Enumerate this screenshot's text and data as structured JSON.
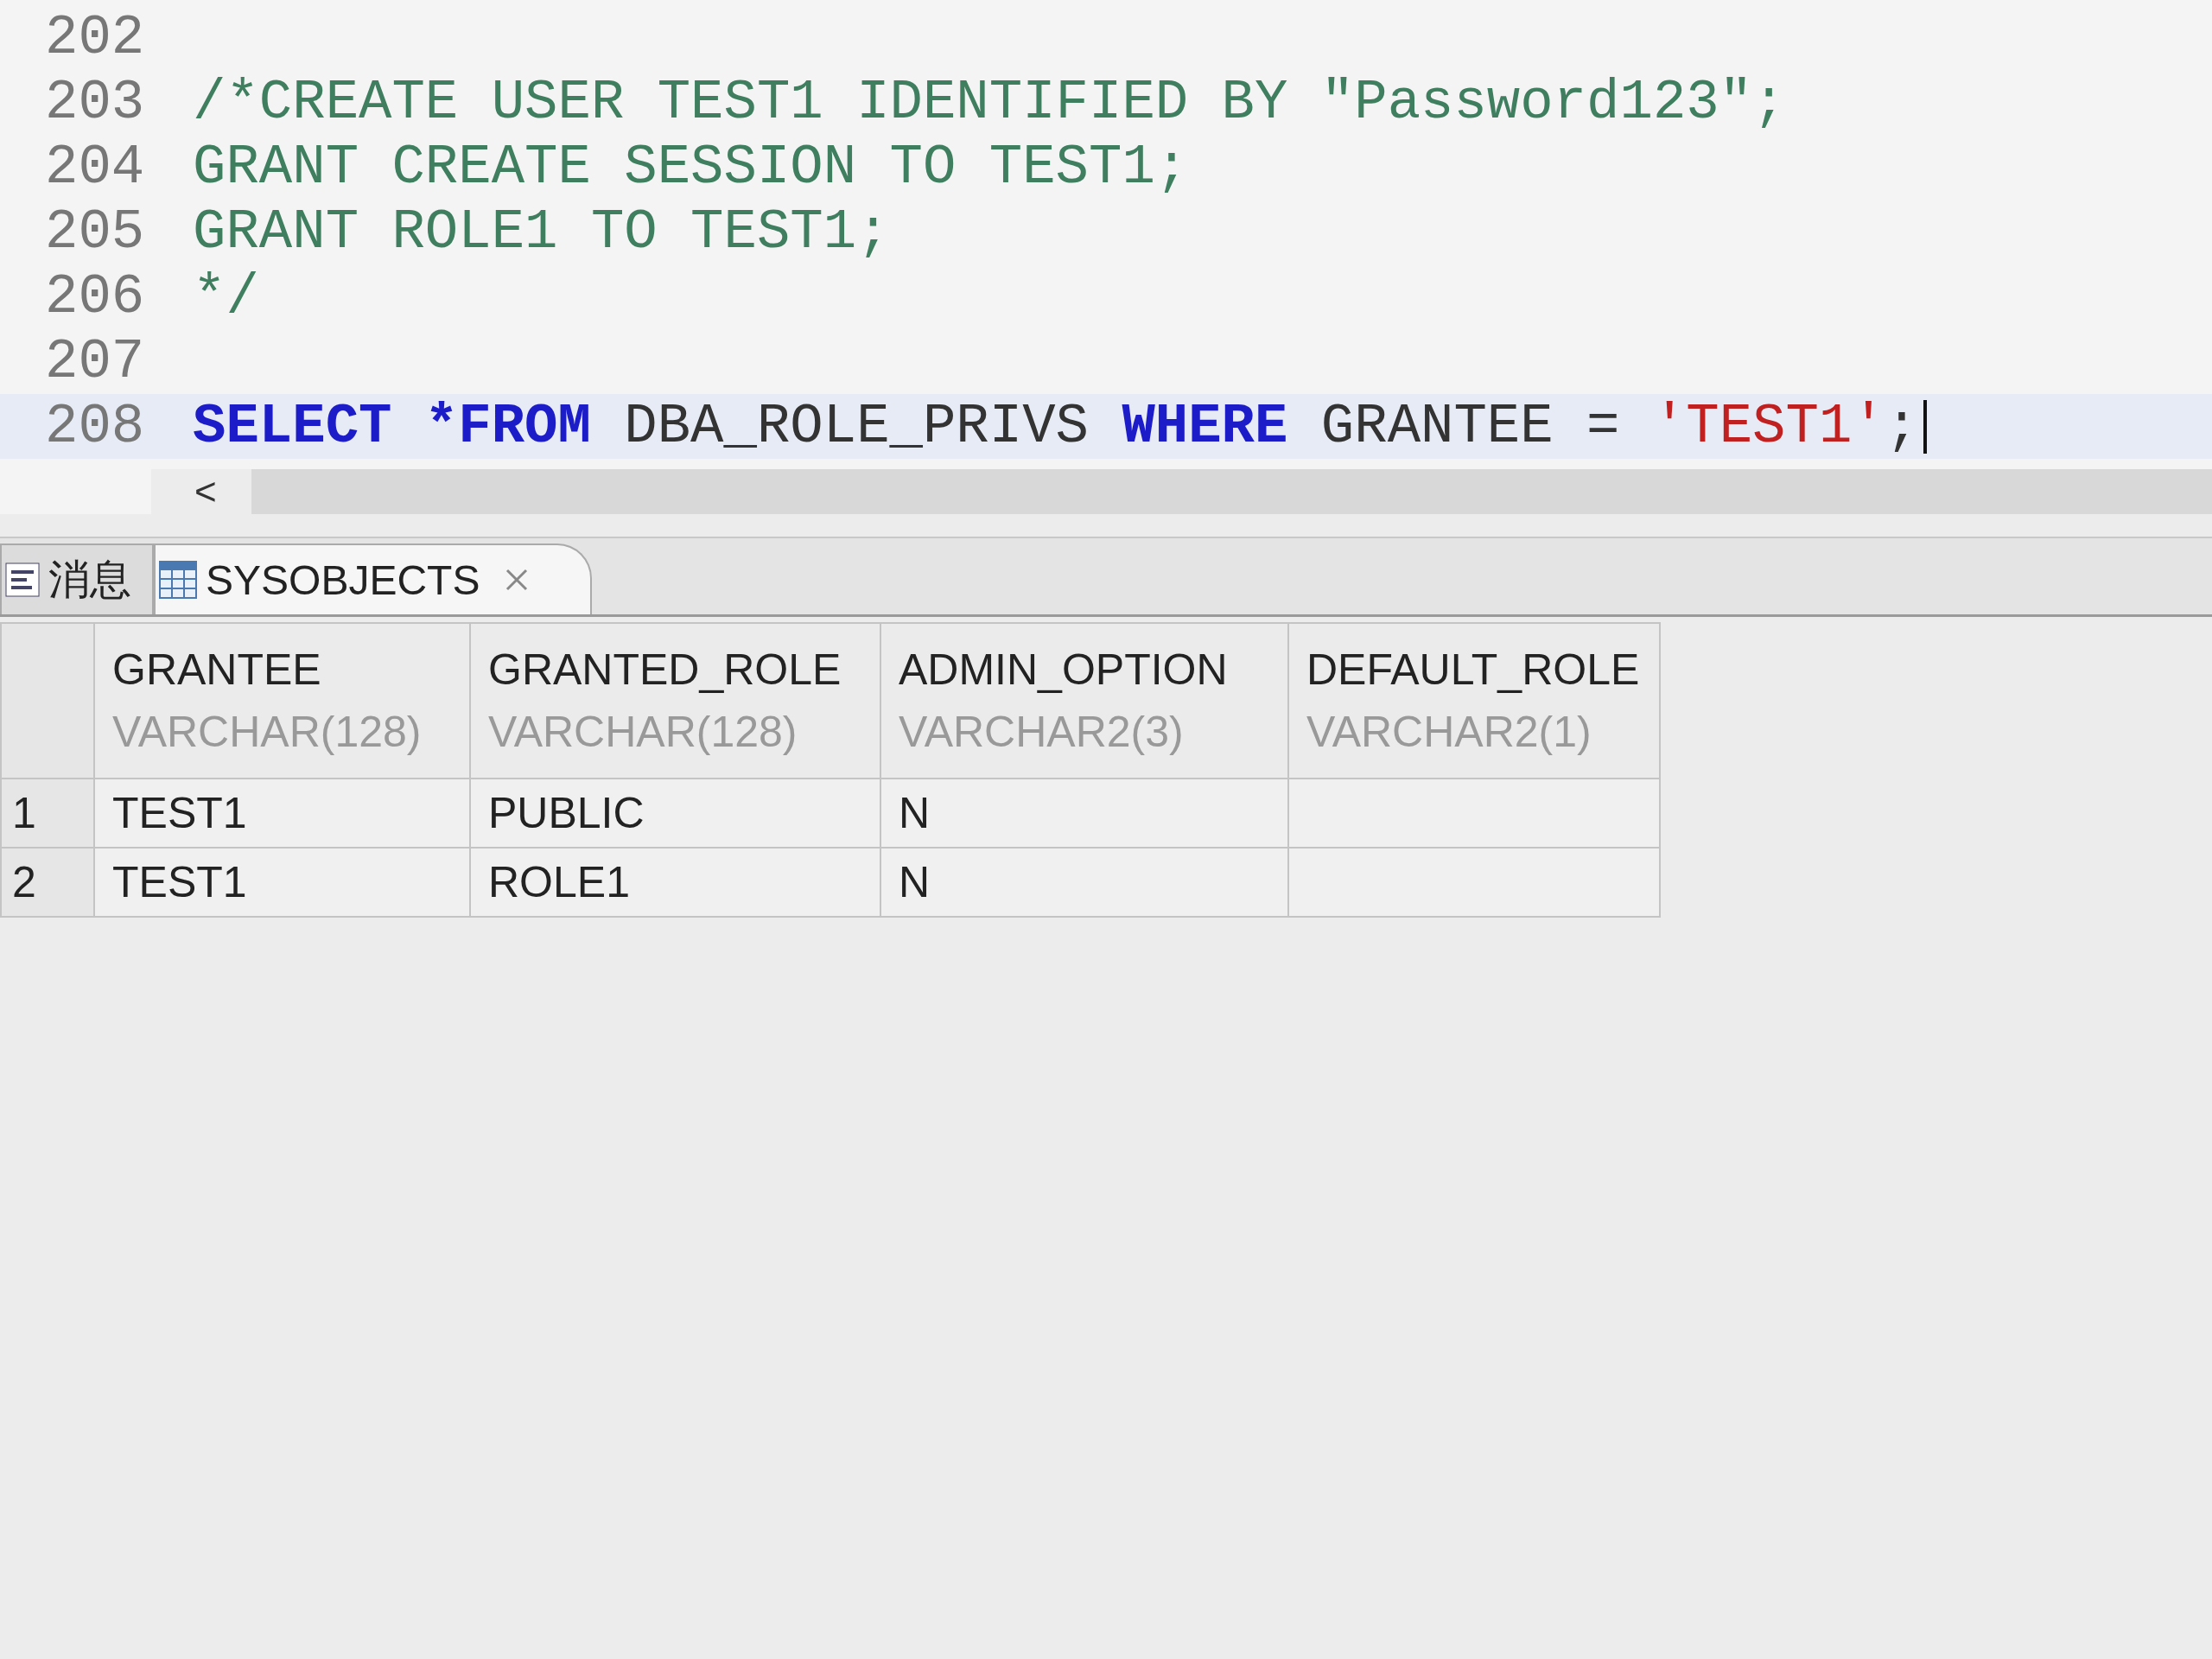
{
  "editor": {
    "lines": [
      {
        "number": "202",
        "selected": false
      },
      {
        "number": "203",
        "selected": false,
        "tokens": [
          {
            "kind": "comment",
            "text": "/*CREATE USER TEST1 IDENTIFIED BY \"Password123\";"
          }
        ]
      },
      {
        "number": "204",
        "selected": false,
        "tokens": [
          {
            "kind": "comment",
            "text": "GRANT CREATE SESSION TO TEST1;"
          }
        ]
      },
      {
        "number": "205",
        "selected": false,
        "tokens": [
          {
            "kind": "comment",
            "text": "GRANT ROLE1 TO TEST1;"
          }
        ]
      },
      {
        "number": "206",
        "selected": false,
        "tokens": [
          {
            "kind": "comment",
            "text": "*/"
          }
        ]
      },
      {
        "number": "207",
        "selected": false
      },
      {
        "number": "208",
        "selected": true,
        "tokens": [
          {
            "kind": "keyword",
            "text": "SELECT *FROM"
          },
          {
            "kind": "plain",
            "text": " DBA_ROLE_PRIVS "
          },
          {
            "kind": "keyword",
            "text": "WHERE"
          },
          {
            "kind": "plain",
            "text": " GRANTEE = "
          },
          {
            "kind": "string",
            "text": "'TEST1'"
          },
          {
            "kind": "plain",
            "text": ";"
          }
        ]
      }
    ],
    "scroll_left": "<"
  },
  "result_tabs": [
    {
      "label": "消息",
      "kind": "messages",
      "selected": false
    },
    {
      "label": "SYSOBJECTS",
      "kind": "table",
      "selected": true
    }
  ],
  "grid": {
    "columns": [
      {
        "name": "GRANTEE",
        "type": "VARCHAR(128)"
      },
      {
        "name": "GRANTED_ROLE",
        "type": "VARCHAR(128)"
      },
      {
        "name": "ADMIN_OPTION",
        "type": "VARCHAR2(3)"
      },
      {
        "name": "DEFAULT_ROLE",
        "type": "VARCHAR2(1)"
      }
    ],
    "rows": [
      {
        "number": "1",
        "cells": [
          "TEST1",
          "PUBLIC",
          "N",
          null
        ]
      },
      {
        "number": "2",
        "cells": [
          "TEST1",
          "ROLE1",
          "N",
          null
        ]
      }
    ]
  }
}
